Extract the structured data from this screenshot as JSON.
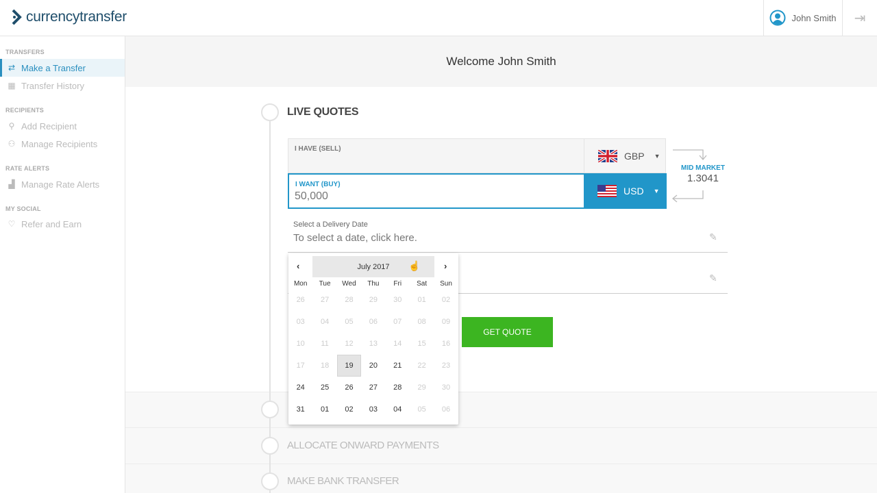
{
  "header": {
    "logo_text": "currencytransfer",
    "user_name": "John Smith",
    "logout_icon": "logout-icon"
  },
  "sidebar": {
    "sections": [
      {
        "title": "TRANSFERS",
        "items": [
          {
            "label": "Make a Transfer",
            "icon": "swap-icon",
            "active": true
          },
          {
            "label": "Transfer History",
            "icon": "calendar-icon"
          }
        ]
      },
      {
        "title": "RECIPIENTS",
        "items": [
          {
            "label": "Add Recipient",
            "icon": "add-user-icon"
          },
          {
            "label": "Manage Recipients",
            "icon": "users-icon"
          }
        ]
      },
      {
        "title": "RATE ALERTS",
        "items": [
          {
            "label": "Manage Rate Alerts",
            "icon": "chart-icon"
          }
        ]
      },
      {
        "title": "MY SOCIAL",
        "items": [
          {
            "label": "Refer and Earn",
            "icon": "heart-icon"
          }
        ]
      }
    ]
  },
  "main": {
    "welcome": "Welcome John Smith",
    "live_quotes": {
      "title": "LIVE QUOTES",
      "sell_label": "I HAVE (SELL)",
      "sell_currency": "GBP",
      "buy_label": "I WANT (BUY)",
      "buy_amount": "50,000",
      "buy_currency": "USD",
      "mid_market_label": "MID MARKET",
      "mid_market_rate": "1.3041",
      "delivery_label": "Select a Delivery Date",
      "delivery_placeholder": "To select a date, click here.",
      "get_quote": "GET QUOTE"
    },
    "steps": [
      "ALLOCATE ONWARD PAYMENTS",
      "MAKE BANK TRANSFER"
    ]
  },
  "calendar": {
    "month": "July 2017",
    "weekdays": [
      "Mon",
      "Tue",
      "Wed",
      "Thu",
      "Fri",
      "Sat",
      "Sun"
    ],
    "weeks": [
      [
        [
          "26",
          0
        ],
        [
          "27",
          0
        ],
        [
          "28",
          0
        ],
        [
          "29",
          0
        ],
        [
          "30",
          0
        ],
        [
          "01",
          0
        ],
        [
          "02",
          0
        ]
      ],
      [
        [
          "03",
          0
        ],
        [
          "04",
          0
        ],
        [
          "05",
          0
        ],
        [
          "06",
          0
        ],
        [
          "07",
          0
        ],
        [
          "08",
          0
        ],
        [
          "09",
          0
        ]
      ],
      [
        [
          "10",
          0
        ],
        [
          "11",
          0
        ],
        [
          "12",
          0
        ],
        [
          "13",
          0
        ],
        [
          "14",
          0
        ],
        [
          "15",
          0
        ],
        [
          "16",
          0
        ]
      ],
      [
        [
          "17",
          0
        ],
        [
          "18",
          0
        ],
        [
          "19",
          2
        ],
        [
          "20",
          1
        ],
        [
          "21",
          1
        ],
        [
          "22",
          0
        ],
        [
          "23",
          0
        ]
      ],
      [
        [
          "24",
          1
        ],
        [
          "25",
          1
        ],
        [
          "26",
          1
        ],
        [
          "27",
          1
        ],
        [
          "28",
          1
        ],
        [
          "29",
          0
        ],
        [
          "30",
          0
        ]
      ],
      [
        [
          "31",
          1
        ],
        [
          "01",
          1
        ],
        [
          "02",
          1
        ],
        [
          "03",
          1
        ],
        [
          "04",
          1
        ],
        [
          "05",
          0
        ],
        [
          "06",
          0
        ]
      ]
    ]
  },
  "colors": {
    "accent": "#2196c9",
    "brand": "#1f4e6b",
    "quote_button": "#3cb521"
  }
}
